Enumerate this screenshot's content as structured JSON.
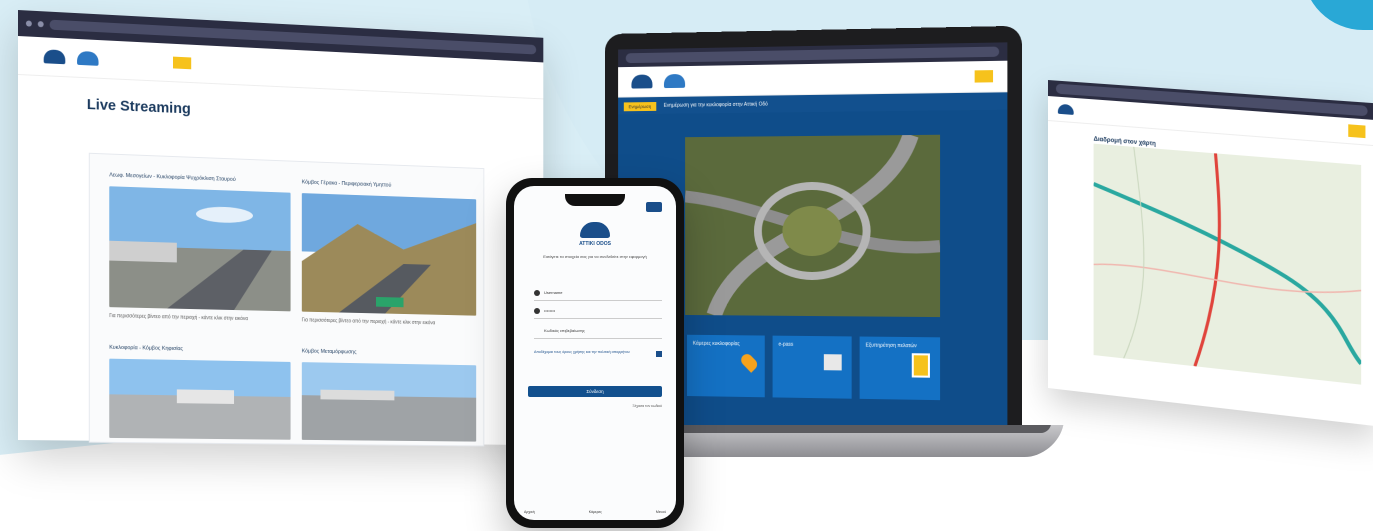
{
  "left_browser": {
    "page_title": "Live Streaming",
    "cameras": [
      {
        "title": "Λεωφ. Μεσογείων - Κυκλοφορία Ψυχρόκλιση Σταυρού",
        "caption": "Για περισσότερες βίντεο από την περιοχή - κάντε κλικ στην εικόνα"
      },
      {
        "title": "Κόμβος Γέρακα - Περιφερειακή Υμηττού",
        "caption": "Για περισσότερες βίντεο από την περιοχή - κάντε κλικ στην εικόνα"
      },
      {
        "title": "Κυκλοφορία - Κόμβος Κηφισίας",
        "caption": ""
      },
      {
        "title": "Κόμβος Μεταμόρφωσης",
        "caption": ""
      }
    ]
  },
  "laptop": {
    "alert_button": "Ενημέρωση",
    "alert_text": "Ενημέρωση για την κυκλοφορία στην Αττική Οδό",
    "cards": [
      {
        "label": "Κάμερες κυκλοφορίας"
      },
      {
        "label": "e-pass"
      },
      {
        "label": "Εξυπηρέτηση πελατών"
      }
    ]
  },
  "right_browser": {
    "heading": "Διαδρομή στον χάρτη"
  },
  "phone": {
    "brand": "ATTIKI ODOS",
    "intro": "Εισάγετε τα στοιχεία σας για να συνδεθείτε στην εφαρμογή",
    "username_placeholder": "Username",
    "password_placeholder": "••••••••",
    "code_placeholder": "Κωδικός επιβεβαίωσης",
    "terms_text": "Αποδέχομαι τους όρους χρήσης και την πολιτική απορρήτου",
    "login_button": "Σύνδεση",
    "forgot_link": "Ξέχασα τον κωδικό",
    "footer": [
      "Αρχική",
      "Κάμερες",
      "Μενού"
    ]
  },
  "colors": {
    "brand_blue": "#12508e",
    "accent_yellow": "#f6c21c",
    "card_blue": "#1471c4",
    "bg_light_blue": "#d9eef6"
  }
}
